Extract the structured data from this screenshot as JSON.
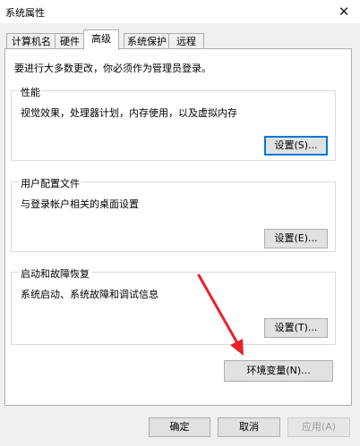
{
  "window": {
    "title": "系统属性"
  },
  "tabs": [
    {
      "label": "计算机名"
    },
    {
      "label": "硬件"
    },
    {
      "label": "高级"
    },
    {
      "label": "系统保护"
    },
    {
      "label": "远程"
    }
  ],
  "notice": "要进行大多数更改，你必须作为管理员登录。",
  "performance": {
    "title": "性能",
    "description": "视觉效果，处理器计划，内存使用，以及虚拟内存",
    "button": "设置(S)..."
  },
  "user_profiles": {
    "title": "用户配置文件",
    "description": "与登录帐户相关的桌面设置",
    "button": "设置(E)..."
  },
  "startup_recovery": {
    "title": "启动和故障恢复",
    "description": "系统启动、系统故障和调试信息",
    "button": "设置(T)..."
  },
  "env_button": "环境变量(N)...",
  "footer": {
    "ok": "确定",
    "cancel": "取消",
    "apply": "应用(A)"
  },
  "colors": {
    "annotation_arrow": "#e8202a",
    "focus_border": "#0078d7"
  }
}
